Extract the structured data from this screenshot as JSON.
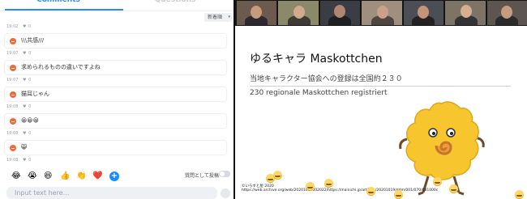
{
  "tabs": {
    "comments": "Comments",
    "questions": "Questions"
  },
  "sort": {
    "selected": "新着順",
    "caret": "▾"
  },
  "messages": [
    {
      "time": "19:02",
      "likes": "0",
      "text": ""
    },
    {
      "time": "19:07",
      "likes": "0",
      "text": "\\\\\\共感///"
    },
    {
      "time": "19:07",
      "likes": "0",
      "text": "求められるものの違いですよね"
    },
    {
      "time": "19:08",
      "likes": "0",
      "text": "猫耳じゃん"
    },
    {
      "time": "19:08",
      "likes": "0",
      "text": "😀😀😀"
    },
    {
      "time": "19:08",
      "likes": "0",
      "text": "😸"
    }
  ],
  "reactions": [
    "😂",
    "😭",
    "😆",
    "👍",
    "👏",
    "❤️"
  ],
  "plus": "+",
  "anon_label": "質問として投稿",
  "input": {
    "placeholder": "Input text here..."
  },
  "slide": {
    "title": "ゆるキャラ Maskottchen",
    "line1": "当地キャラクター協会への登録は全国約２３０",
    "line2": "230 regionale Maskottchen registriert",
    "credit_a": "©いらすと屋 2020",
    "credit_b": "https://web.archive.org/web/20201019002022/https://mainichi.jp/articles/20201019/ddm/001/070/081000c"
  },
  "colors": {
    "accent": "#2a8bf2",
    "avatar": "#f1683a",
    "like_button": "#1a8cff"
  },
  "icons": {
    "heart": "♥",
    "send": "send-icon"
  }
}
